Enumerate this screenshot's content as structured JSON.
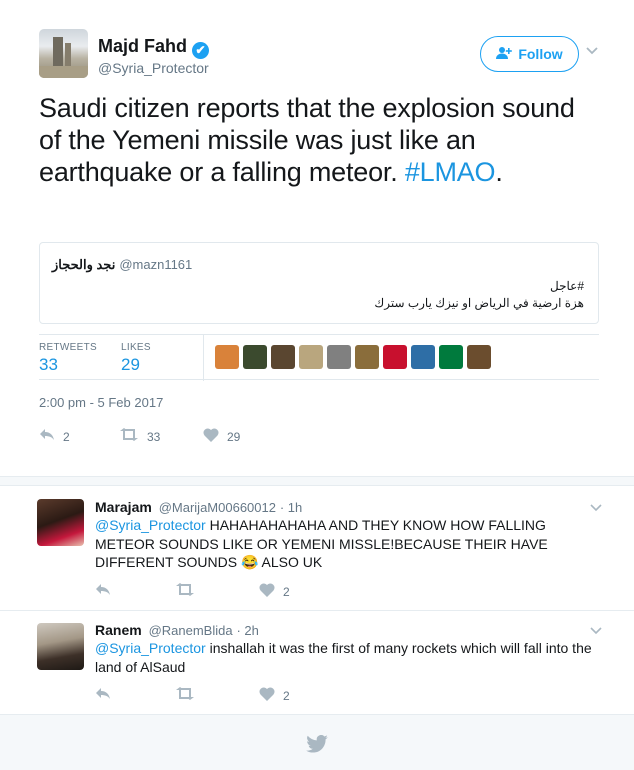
{
  "tweet": {
    "author_name": "Majd Fahd",
    "verified_mark": "✔",
    "handle": "@Syria_Protector",
    "follow_label": "Follow",
    "follow_icon": "person-plus-icon",
    "text": "Saudi citizen reports that the explosion sound of the Yemeni missile was just like an earthquake or a falling meteor. ",
    "hashtag": "#LMAO",
    "text_end": ".",
    "quote": {
      "name": "نجد والحجاز",
      "handle": "@mazn1161",
      "line1": "#عاجل",
      "line2": "هزة ارضية في الرياض او نيزك يارب سترك"
    },
    "stats": {
      "retweets_label": "RETWEETS",
      "retweets": "33",
      "likes_label": "LIKES",
      "likes": "29"
    },
    "liker_colors": [
      "#d9823a",
      "#3b4a2e",
      "#5a4630",
      "#b9a67e",
      "#808080",
      "#8a6d3b",
      "#c8102e",
      "#2e6ea6",
      "#007a3d",
      "#6b4d2e"
    ],
    "timestamp": "2:00 pm - 5 Feb 2017",
    "actions": {
      "reply_count": "2",
      "retweet_count": "33",
      "like_count": "29"
    }
  },
  "replies": [
    {
      "name": "Marajam",
      "handle": "@MarijaM00660012",
      "time": "· 1h",
      "mention": "@Syria_Protector",
      "text": " HAHAHAHAHAHA AND THEY KNOW HOW FALLING METEOR SOUNDS LIKE OR YEMENI MISSLE!BECAUSE THEIR HAVE DIFFERENT SOUNDS 😂 ALSO UK",
      "like_count": "2"
    },
    {
      "name": "Ranem",
      "handle": "@RanemBlida",
      "time": "· 2h",
      "mention": "@Syria_Protector",
      "text": " inshallah it was the first of many rockets which will fall into the land of AlSaud",
      "like_count": "2"
    }
  ],
  "footer": {
    "icon": "twitter-bird-icon"
  }
}
